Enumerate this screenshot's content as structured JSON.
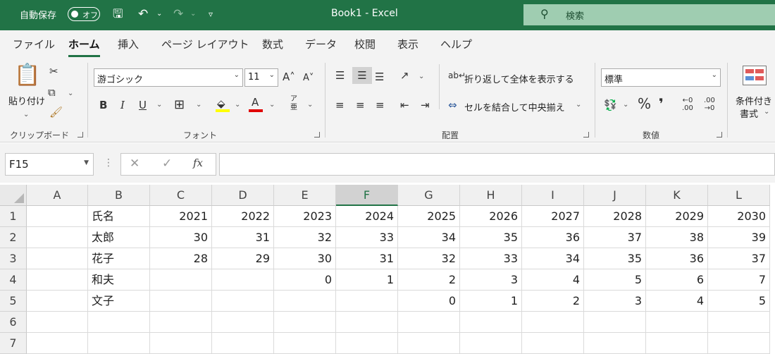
{
  "titlebar": {
    "autosave_label": "自動保存",
    "autosave_state": "オフ",
    "title": "Book1  -  Excel",
    "search_placeholder": "検索"
  },
  "menu": {
    "tabs": [
      "ファイル",
      "ホーム",
      "挿入",
      "ページ レイアウト",
      "数式",
      "データ",
      "校閲",
      "表示",
      "ヘルプ"
    ],
    "active": "ホーム"
  },
  "ribbon": {
    "clipboard": {
      "paste_label": "貼り付け",
      "group_label": "クリップボード"
    },
    "font": {
      "font_name": "游ゴシック",
      "font_size": "11",
      "bold": "B",
      "italic": "I",
      "underline": "U",
      "group_label": "フォント"
    },
    "alignment": {
      "wrap_label": "折り返して全体を表示する",
      "merge_label": "セルを結合して中央揃え",
      "group_label": "配置"
    },
    "number": {
      "format": "標準",
      "percent": "%",
      "comma": "❜",
      "group_label": "数値"
    },
    "styles": {
      "cond_format_line1": "条件付き",
      "cond_format_line2": "書式"
    }
  },
  "formula_bar": {
    "name_box": "F15",
    "fx": "fx",
    "content": ""
  },
  "grid": {
    "columns": [
      "A",
      "B",
      "C",
      "D",
      "E",
      "F",
      "G",
      "H",
      "I",
      "J",
      "K",
      "L"
    ],
    "selected_column": "F",
    "rows": [
      "1",
      "2",
      "3",
      "4",
      "5",
      "6",
      "7"
    ],
    "cells": [
      [
        "",
        "氏名",
        "2021",
        "2022",
        "2023",
        "2024",
        "2025",
        "2026",
        "2027",
        "2028",
        "2029",
        "2030"
      ],
      [
        "",
        "太郎",
        "30",
        "31",
        "32",
        "33",
        "34",
        "35",
        "36",
        "37",
        "38",
        "39"
      ],
      [
        "",
        "花子",
        "28",
        "29",
        "30",
        "31",
        "32",
        "33",
        "34",
        "35",
        "36",
        "37"
      ],
      [
        "",
        "和夫",
        "",
        "",
        "0",
        "1",
        "2",
        "3",
        "4",
        "5",
        "6",
        "7"
      ],
      [
        "",
        "文子",
        "",
        "",
        "",
        "",
        "0",
        "1",
        "2",
        "3",
        "4",
        "5"
      ],
      [
        "",
        "",
        "",
        "",
        "",
        "",
        "",
        "",
        "",
        "",
        "",
        ""
      ],
      [
        "",
        "",
        "",
        "",
        "",
        "",
        "",
        "",
        "",
        "",
        "",
        ""
      ]
    ]
  }
}
